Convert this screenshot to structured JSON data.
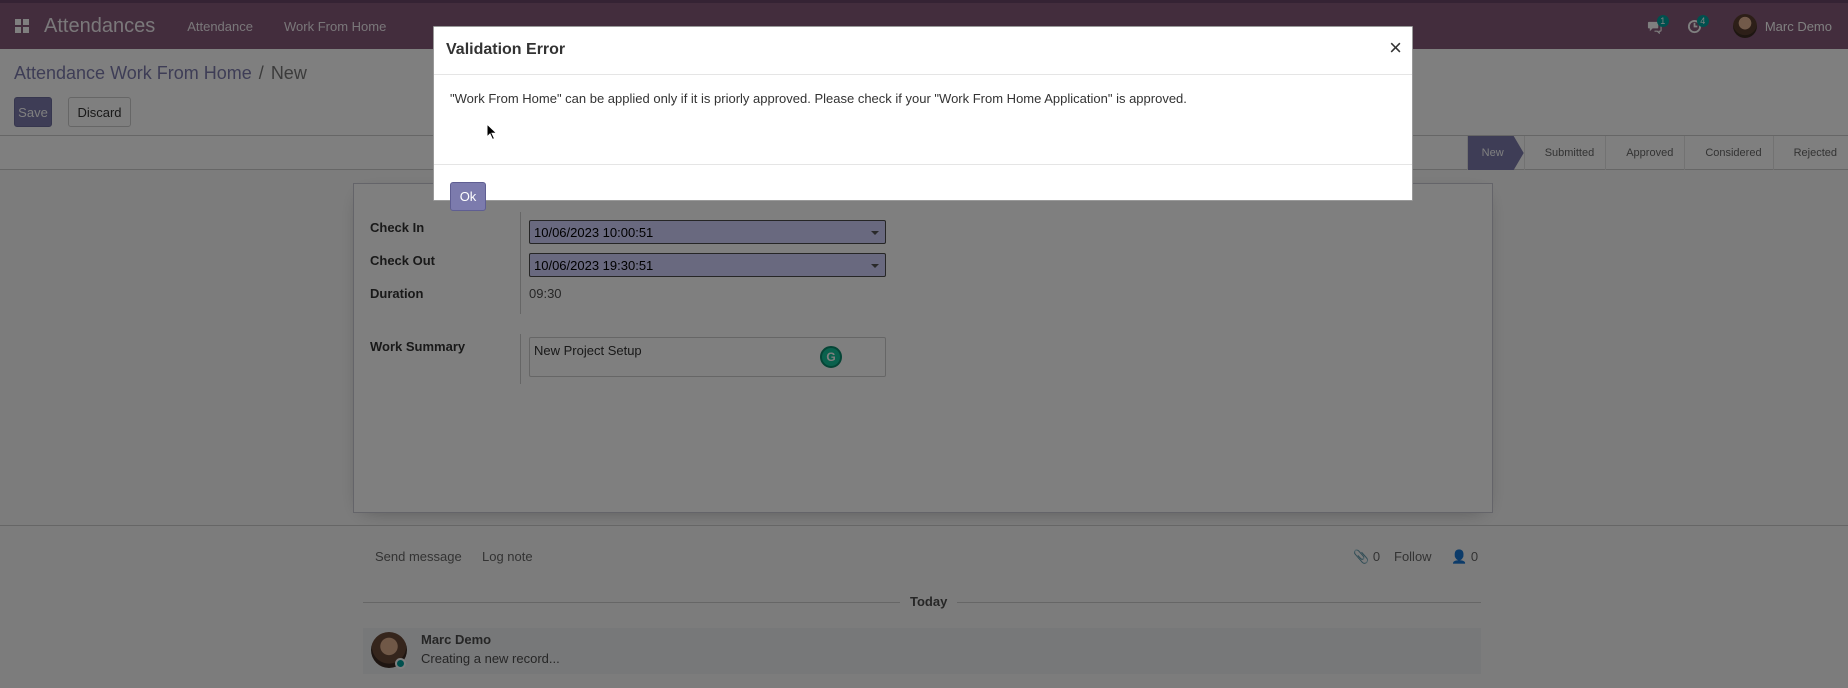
{
  "navbar": {
    "app_title": "Attendances",
    "menu": [
      "Attendance",
      "Work From Home"
    ],
    "messages_count": "1",
    "activities_count": "4",
    "user_name": "Marc Demo"
  },
  "breadcrumb": {
    "parent": "Attendance Work From Home",
    "separator": "/",
    "current": "New"
  },
  "buttons": {
    "save": "Save",
    "discard": "Discard"
  },
  "statusbar": {
    "stages": [
      "New",
      "Submitted",
      "Approved",
      "Considered",
      "Rejected"
    ],
    "active": "New"
  },
  "form": {
    "check_in_label": "Check In",
    "check_in_value": "10/06/2023 10:00:51",
    "check_out_label": "Check Out",
    "check_out_value": "10/06/2023 19:30:51",
    "duration_label": "Duration",
    "duration_value": "09:30",
    "work_summary_label": "Work Summary",
    "work_summary_value": "New Project Setup"
  },
  "chatter": {
    "send_message": "Send message",
    "log_note": "Log note",
    "attachments_count": "0",
    "follow": "Follow",
    "followers_count": "0",
    "date_separator": "Today",
    "message_author": "Marc Demo",
    "message_body": "Creating a new record..."
  },
  "modal": {
    "title": "Validation Error",
    "close": "×",
    "message": "\"Work From Home\" can be applied only if it is priorly approved. Please check if your \"Work From Home Application\" is approved.",
    "ok": "Ok"
  },
  "colors": {
    "navbar": "#875a7b",
    "primary": "#7c7bad",
    "date_field_bg": "#d2d2ff"
  }
}
